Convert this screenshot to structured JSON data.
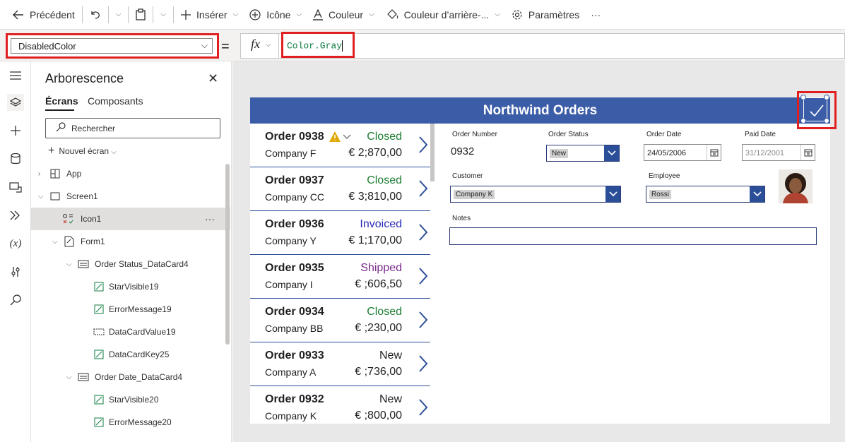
{
  "toolbar": {
    "back": "Précédent",
    "insert": "Insérer",
    "icon": "Icône",
    "color": "Couleur",
    "bg_color": "Couleur d’arrière-...",
    "settings": "Paramètres",
    "more": "···"
  },
  "formula_bar": {
    "property": "DisabledColor",
    "equals": "=",
    "fx": "fx",
    "formula": "Color.Gray"
  },
  "tree": {
    "title": "Arborescence",
    "tabs": [
      "Écrans",
      "Composants"
    ],
    "search_placeholder": "Rechercher",
    "new_screen": "Nouvel écran",
    "nodes": [
      "App",
      "Screen1",
      "Icon1",
      "Form1",
      "Order Status_DataCard4",
      "StarVisible19",
      "ErrorMessage19",
      "DataCardValue19",
      "DataCardKey25",
      "Order Date_DataCard4",
      "StarVisible20",
      "ErrorMessage20"
    ],
    "node_more": "···"
  },
  "app": {
    "title": "Northwind Orders",
    "orders": [
      {
        "title": "Order 0938",
        "company": "Company F",
        "status": "Closed",
        "amount": "€ 2;870,00",
        "warning": true
      },
      {
        "title": "Order 0937",
        "company": "Company CC",
        "status": "Closed",
        "amount": "€ 3;810,00"
      },
      {
        "title": "Order 0936",
        "company": "Company Y",
        "status": "Invoiced",
        "amount": "€ 1;170,00"
      },
      {
        "title": "Order 0935",
        "company": "Company I",
        "status": "Shipped",
        "amount": "€ ;606,50"
      },
      {
        "title": "Order 0934",
        "company": "Company BB",
        "status": "Closed",
        "amount": "€ ;230,00"
      },
      {
        "title": "Order 0933",
        "company": "Company A",
        "status": "New",
        "amount": "€ ;736,00"
      },
      {
        "title": "Order 0932",
        "company": "Company K",
        "status": "New",
        "amount": "€ ;800,00"
      }
    ],
    "status_colors": {
      "Closed": "#1e7e34",
      "Invoiced": "#2b2bb8",
      "Shipped": "#7b2a8a",
      "New": "#201f1e"
    },
    "form": {
      "order_number_label": "Order Number",
      "order_number": "0932",
      "order_status_label": "Order Status",
      "order_status": "New",
      "order_date_label": "Order Date",
      "order_date": "24/05/2006",
      "paid_date_label": "Paid Date",
      "paid_date": "31/12/2001",
      "customer_label": "Customer",
      "customer": "Company K",
      "employee_label": "Employee",
      "employee": "Rossi",
      "notes_label": "Notes"
    }
  },
  "colors": {
    "header": "#3b5da7",
    "highlight": "#e02020"
  }
}
